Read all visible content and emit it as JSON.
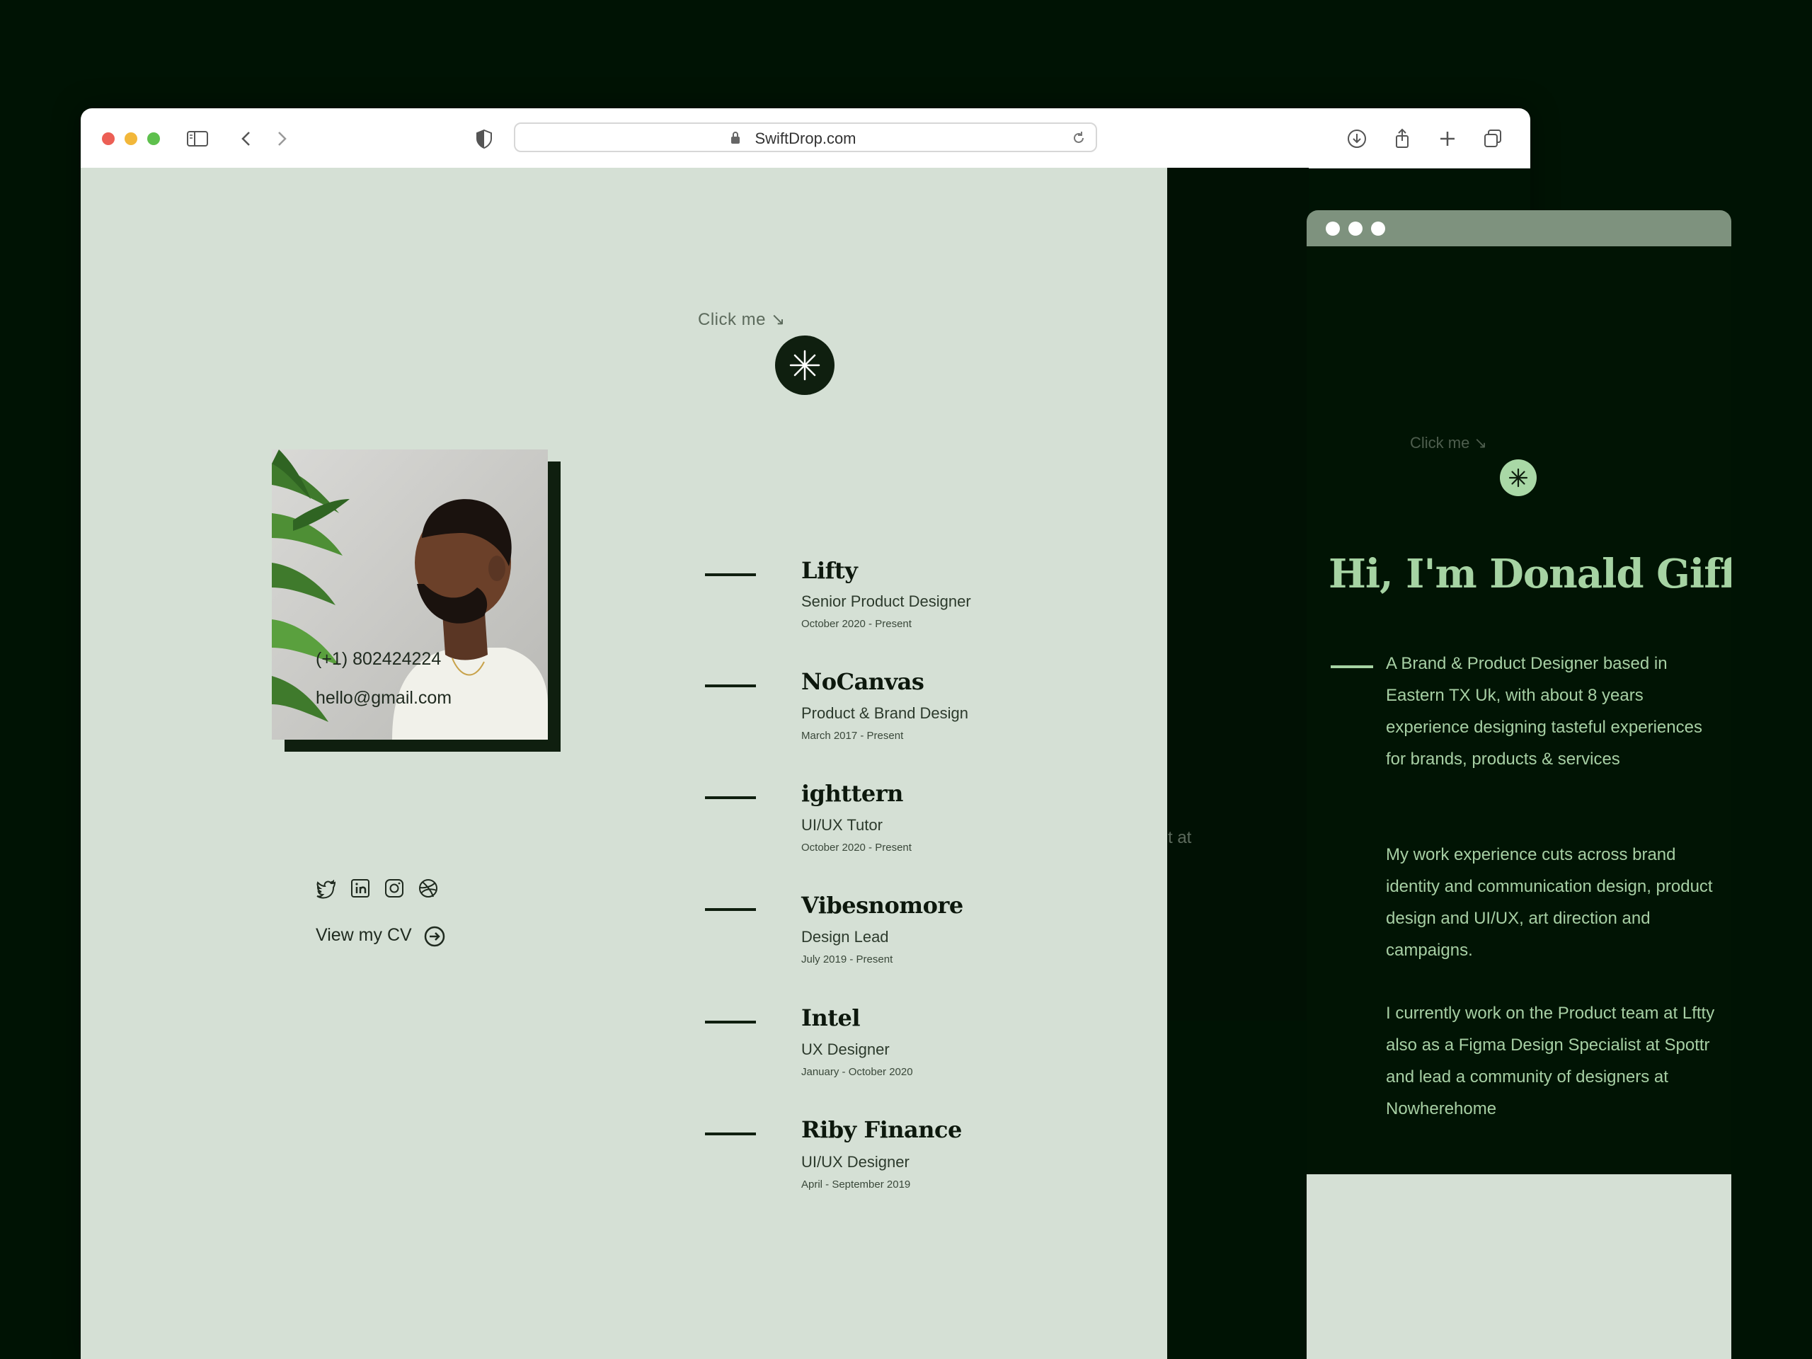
{
  "browser": {
    "url": "SwiftDrop.com",
    "icons": [
      "sidebar-icon",
      "back-icon",
      "forward-icon",
      "privacy-shield-icon",
      "lock-icon",
      "reload-icon",
      "download-icon",
      "share-icon",
      "new-tab-icon",
      "tabs-overview-icon"
    ]
  },
  "portfolio": {
    "click_me": "Click me ↘",
    "phone": "(+1) 802424224",
    "email": "hello@gmail.com",
    "cv_label": "View my CV",
    "social_icons": [
      "twitter-icon",
      "linkedin-icon",
      "instagram-icon",
      "dribbble-icon"
    ],
    "experience": [
      {
        "company": "Lifty",
        "role": "Senior Product Designer",
        "dates": "October 2020 - Present"
      },
      {
        "company": "NoCanvas",
        "role": "Product & Brand Design",
        "dates": "March 2017 - Present"
      },
      {
        "company": "ighttern",
        "role": "UI/UX Tutor",
        "dates": "October 2020 - Present"
      },
      {
        "company": "Vibesnomore",
        "role": "Design Lead",
        "dates": "July 2019 - Present"
      },
      {
        "company": "Intel",
        "role": "UX Designer",
        "dates": "January - October 2020"
      },
      {
        "company": "Riby Finance",
        "role": "UI/UX Designer",
        "dates": "April - September 2019"
      }
    ],
    "partial_text": "t at"
  },
  "mobile": {
    "click_me": "Click me ↘",
    "title": "Hi,  I'm Donald Giff",
    "paragraphs": [
      "A Brand & Product Designer based in Eastern TX Uk, with about 8  years experience designing tasteful experiences for brands, products & services",
      "My work experience cuts across brand identity and communication design, product design and UI/UX, art direction and campaigns.",
      "I currently work on the Product team at Lftty also as a Figma Design Specialist at Spottr and lead a community of designers at Nowherehome"
    ]
  },
  "colors": {
    "background": "#001304",
    "page_bg": "#d5e0d5",
    "accent_dark": "#0f1f0f",
    "accent_green": "#a6d3a3"
  }
}
